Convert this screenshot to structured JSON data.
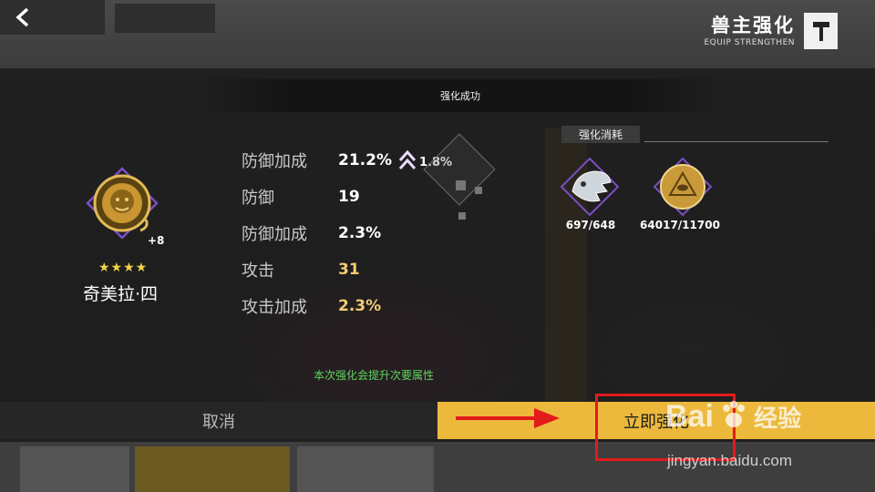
{
  "header": {
    "back_icon": "chevron-left-icon",
    "title": "兽主强化",
    "subtitle": "EQUIP STRENGTHEN",
    "tool_icon": "hammer-icon"
  },
  "modal": {
    "title": "强化成功",
    "item": {
      "level": "+8",
      "stars": "★★★★",
      "name": "奇美拉·四"
    },
    "stats": [
      {
        "label": "防御加成",
        "value": "21.2%",
        "gain": "1.8%"
      },
      {
        "label": "防御",
        "value": "19"
      },
      {
        "label": "防御加成",
        "value": "2.3%"
      },
      {
        "label": "攻击",
        "value": "31"
      },
      {
        "label": "攻击加成",
        "value": "2.3%"
      }
    ],
    "cost": {
      "title": "强化消耗",
      "items": [
        {
          "icon": "beast-material-icon",
          "count": "697/648"
        },
        {
          "icon": "gold-coin-icon",
          "count": "64017/11700"
        }
      ]
    },
    "hint": "本次强化会提升次要属性",
    "cancel_label": "取消",
    "confirm_label": "立即强化"
  },
  "watermark": {
    "brand": "Bai",
    "brand_cn": "经验",
    "url": "jingyan.baidu.com"
  },
  "colors": {
    "accent": "#ecb93c",
    "hint_green": "#5fd55f",
    "highlight_red": "#e21b1b",
    "stat_gold": "#f2cd73"
  }
}
